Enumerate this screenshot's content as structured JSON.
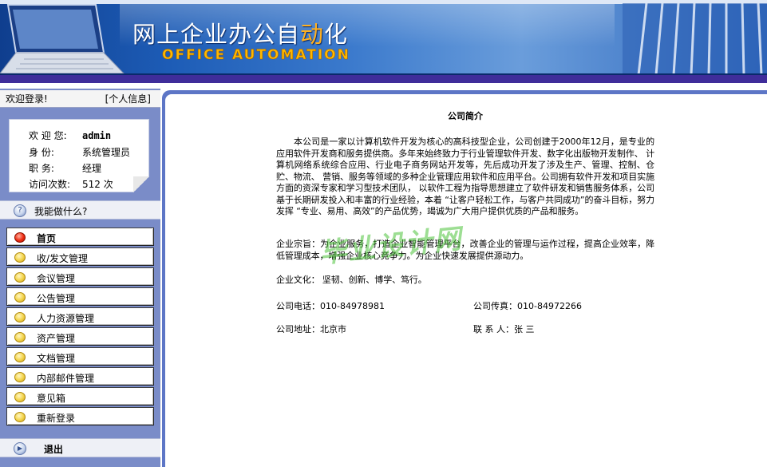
{
  "banner": {
    "title_pre": "网上企业办公自",
    "title_highlight": "动",
    "title_post": "化",
    "subtitle": "OFFICE AUTOMATION"
  },
  "sidebar": {
    "welcome": "欢迎登录!",
    "profile_link": "[个人信息]",
    "user": {
      "name_label": "欢 迎 您:",
      "name": "admin",
      "role_label": "身    份:",
      "role": "系统管理员",
      "title_label": "职    务:",
      "title": "经理",
      "visits_label": "访问次数:",
      "visits": "512 次"
    },
    "help_label": "我能做什么?",
    "menu": [
      {
        "label": "首页",
        "icon": "red-dot-icon",
        "active": true
      },
      {
        "label": "收/发文管理",
        "icon": "yellow-dot-icon"
      },
      {
        "label": "会议管理",
        "icon": "yellow-dot-icon"
      },
      {
        "label": "公告管理",
        "icon": "yellow-dot-icon"
      },
      {
        "label": "人力资源管理",
        "icon": "yellow-dot-icon"
      },
      {
        "label": "资产管理",
        "icon": "yellow-dot-icon"
      },
      {
        "label": "文档管理",
        "icon": "yellow-dot-icon"
      },
      {
        "label": "内部邮件管理",
        "icon": "yellow-dot-icon"
      },
      {
        "label": "意见箱",
        "icon": "yellow-dot-icon"
      },
      {
        "label": "重新登录",
        "icon": "yellow-dot-icon"
      }
    ],
    "logout_label": "退出"
  },
  "content": {
    "title": "公司简介",
    "intro": "本公司是一家以计算机软件开发为核心的高科技型企业，公司创建于2000年12月，是专业的应用软件开发商和服务提供商。多年来始终致力于行业管理软件开发、数字化出版物开发制作、 计算机网络系统综合应用、行业电子商务网站开发等，先后成功开发了涉及生产、管理、控制、仓贮、物流、 营销、服务等领域的多种企业管理应用软件和应用平台。公司拥有软件开发和项目实施方面的资深专家和学习型技术团队， 以软件工程为指导思想建立了软件研发和销售服务体系，公司基于长期研发投入和丰富的行业经验，本着 “让客户轻松工作，与客户共同成功”的奋斗目标，努力发挥 “专业、易用、高效”的产品优势，竭诚为广大用户提供优质的产品和服务。",
    "tenet": "企业宗旨：为企业服务，打造企业智能管理平台，改善企业的管理与运作过程，提高企业效率，降低管理成本，增强企业核心竞争力。为企业快速发展提供源动力。",
    "culture": "企业文化： 坚韧、创新、博学、笃行。",
    "phone": "公司电话：010-84978981",
    "fax": "公司传真：010-84972266",
    "address": "公司地址：北京市",
    "contact": "联 系 人：张 三"
  },
  "watermark": "毕业设计网",
  "colors": {
    "banner_blue": "#1d5cb6",
    "stripe_purple": "#3f2d9a",
    "sidebar_bg": "#7a8cc8",
    "content_frame": "#5d76c6",
    "accent_orange": "#ffb800"
  }
}
